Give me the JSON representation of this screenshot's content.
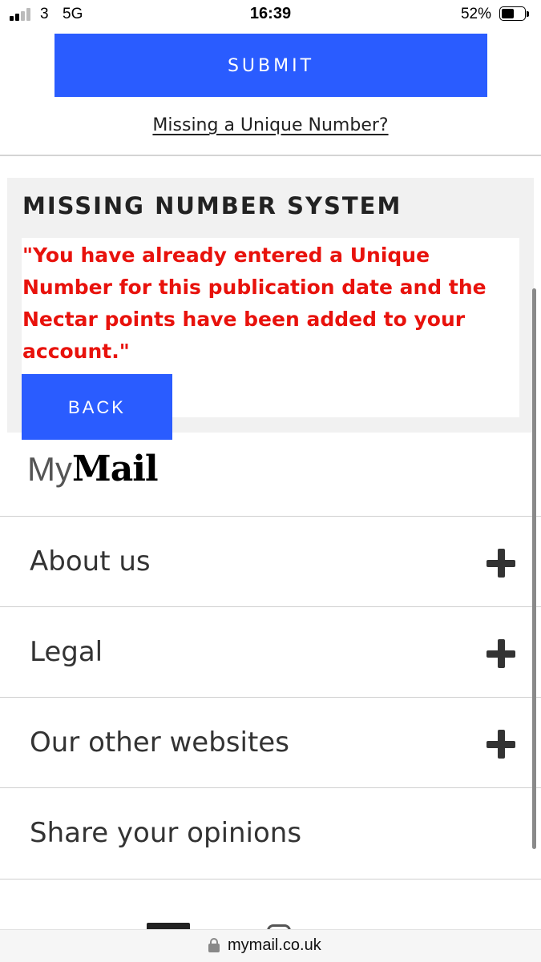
{
  "status_bar": {
    "carrier": "3",
    "network": "5G",
    "time": "16:39",
    "battery": "52%",
    "battery_level": 0.52,
    "signal_bars": 2
  },
  "form": {
    "submit_label": "SUBMIT",
    "missing_link": "Missing a Unique Number?"
  },
  "missing_number": {
    "title": "MISSING NUMBER SYSTEM",
    "message": "\"You have already entered a Unique Number for this publication date and the Nectar points have been added to your account.\"",
    "back_label": "BACK",
    "message_color": "#e8120c"
  },
  "logo": {
    "my": "My",
    "mail": "Mail"
  },
  "footer_menu": [
    {
      "label": "About us",
      "icon": "plus-icon"
    },
    {
      "label": "Legal",
      "icon": "plus-icon"
    },
    {
      "label": "Our other websites",
      "icon": "plus-icon"
    },
    {
      "label": "Share your opinions"
    }
  ],
  "browser": {
    "url": "mymail.co.uk",
    "icon": "lock-icon"
  },
  "colors": {
    "accent": "#2a5cff",
    "panel_bg": "#f1f1f1"
  }
}
